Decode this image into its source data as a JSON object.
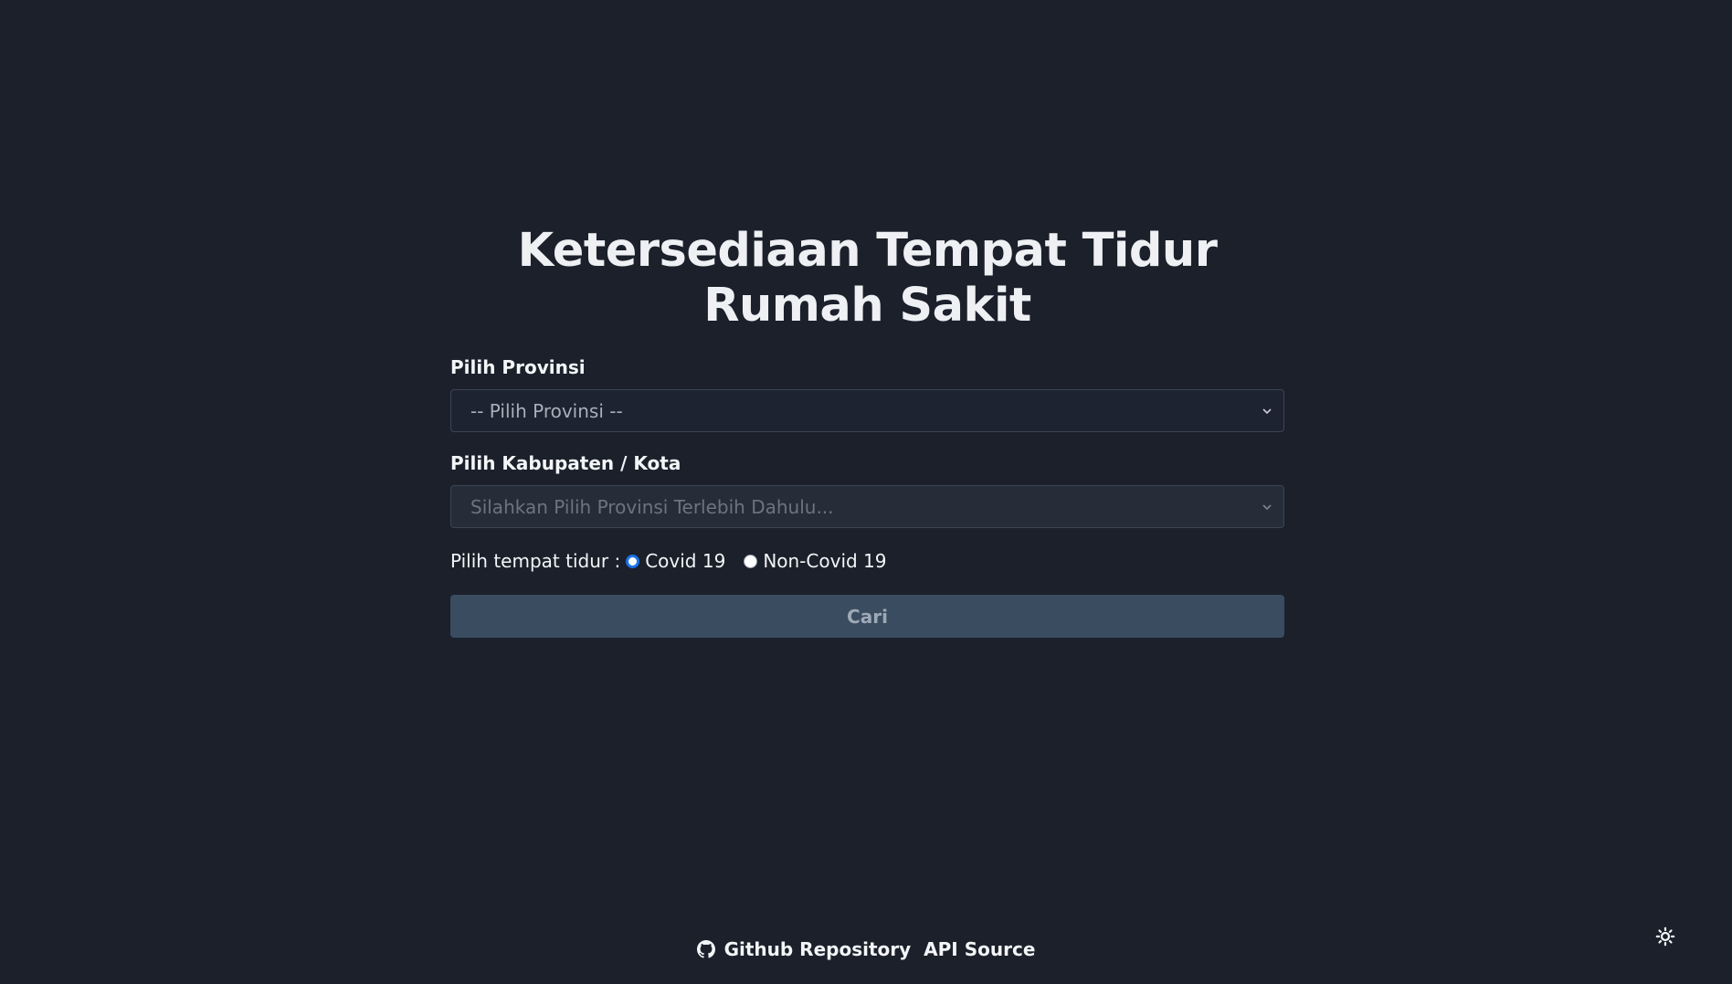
{
  "page": {
    "title": "Ketersediaan Tempat Tidur Rumah Sakit"
  },
  "form": {
    "province_label": "Pilih Provinsi",
    "province_placeholder": "-- Pilih Provinsi --",
    "city_label": "Pilih Kabupaten / Kota",
    "city_placeholder": "Silahkan Pilih Provinsi Terlebih Dahulu...",
    "bed_type_label": "Pilih tempat tidur :",
    "bed_types": [
      {
        "label": "Covid 19",
        "checked": true
      },
      {
        "label": "Non-Covid 19",
        "checked": false
      }
    ],
    "search_button": "Cari"
  },
  "footer": {
    "github_label": "Github Repository",
    "api_label": "API Source"
  },
  "icons": {
    "github": "github-icon",
    "theme": "sun-icon",
    "chevron": "chevron-down-icon"
  },
  "colors": {
    "background": "#1b202b",
    "button": "#394c60",
    "radio_accent": "#1a73e8"
  }
}
